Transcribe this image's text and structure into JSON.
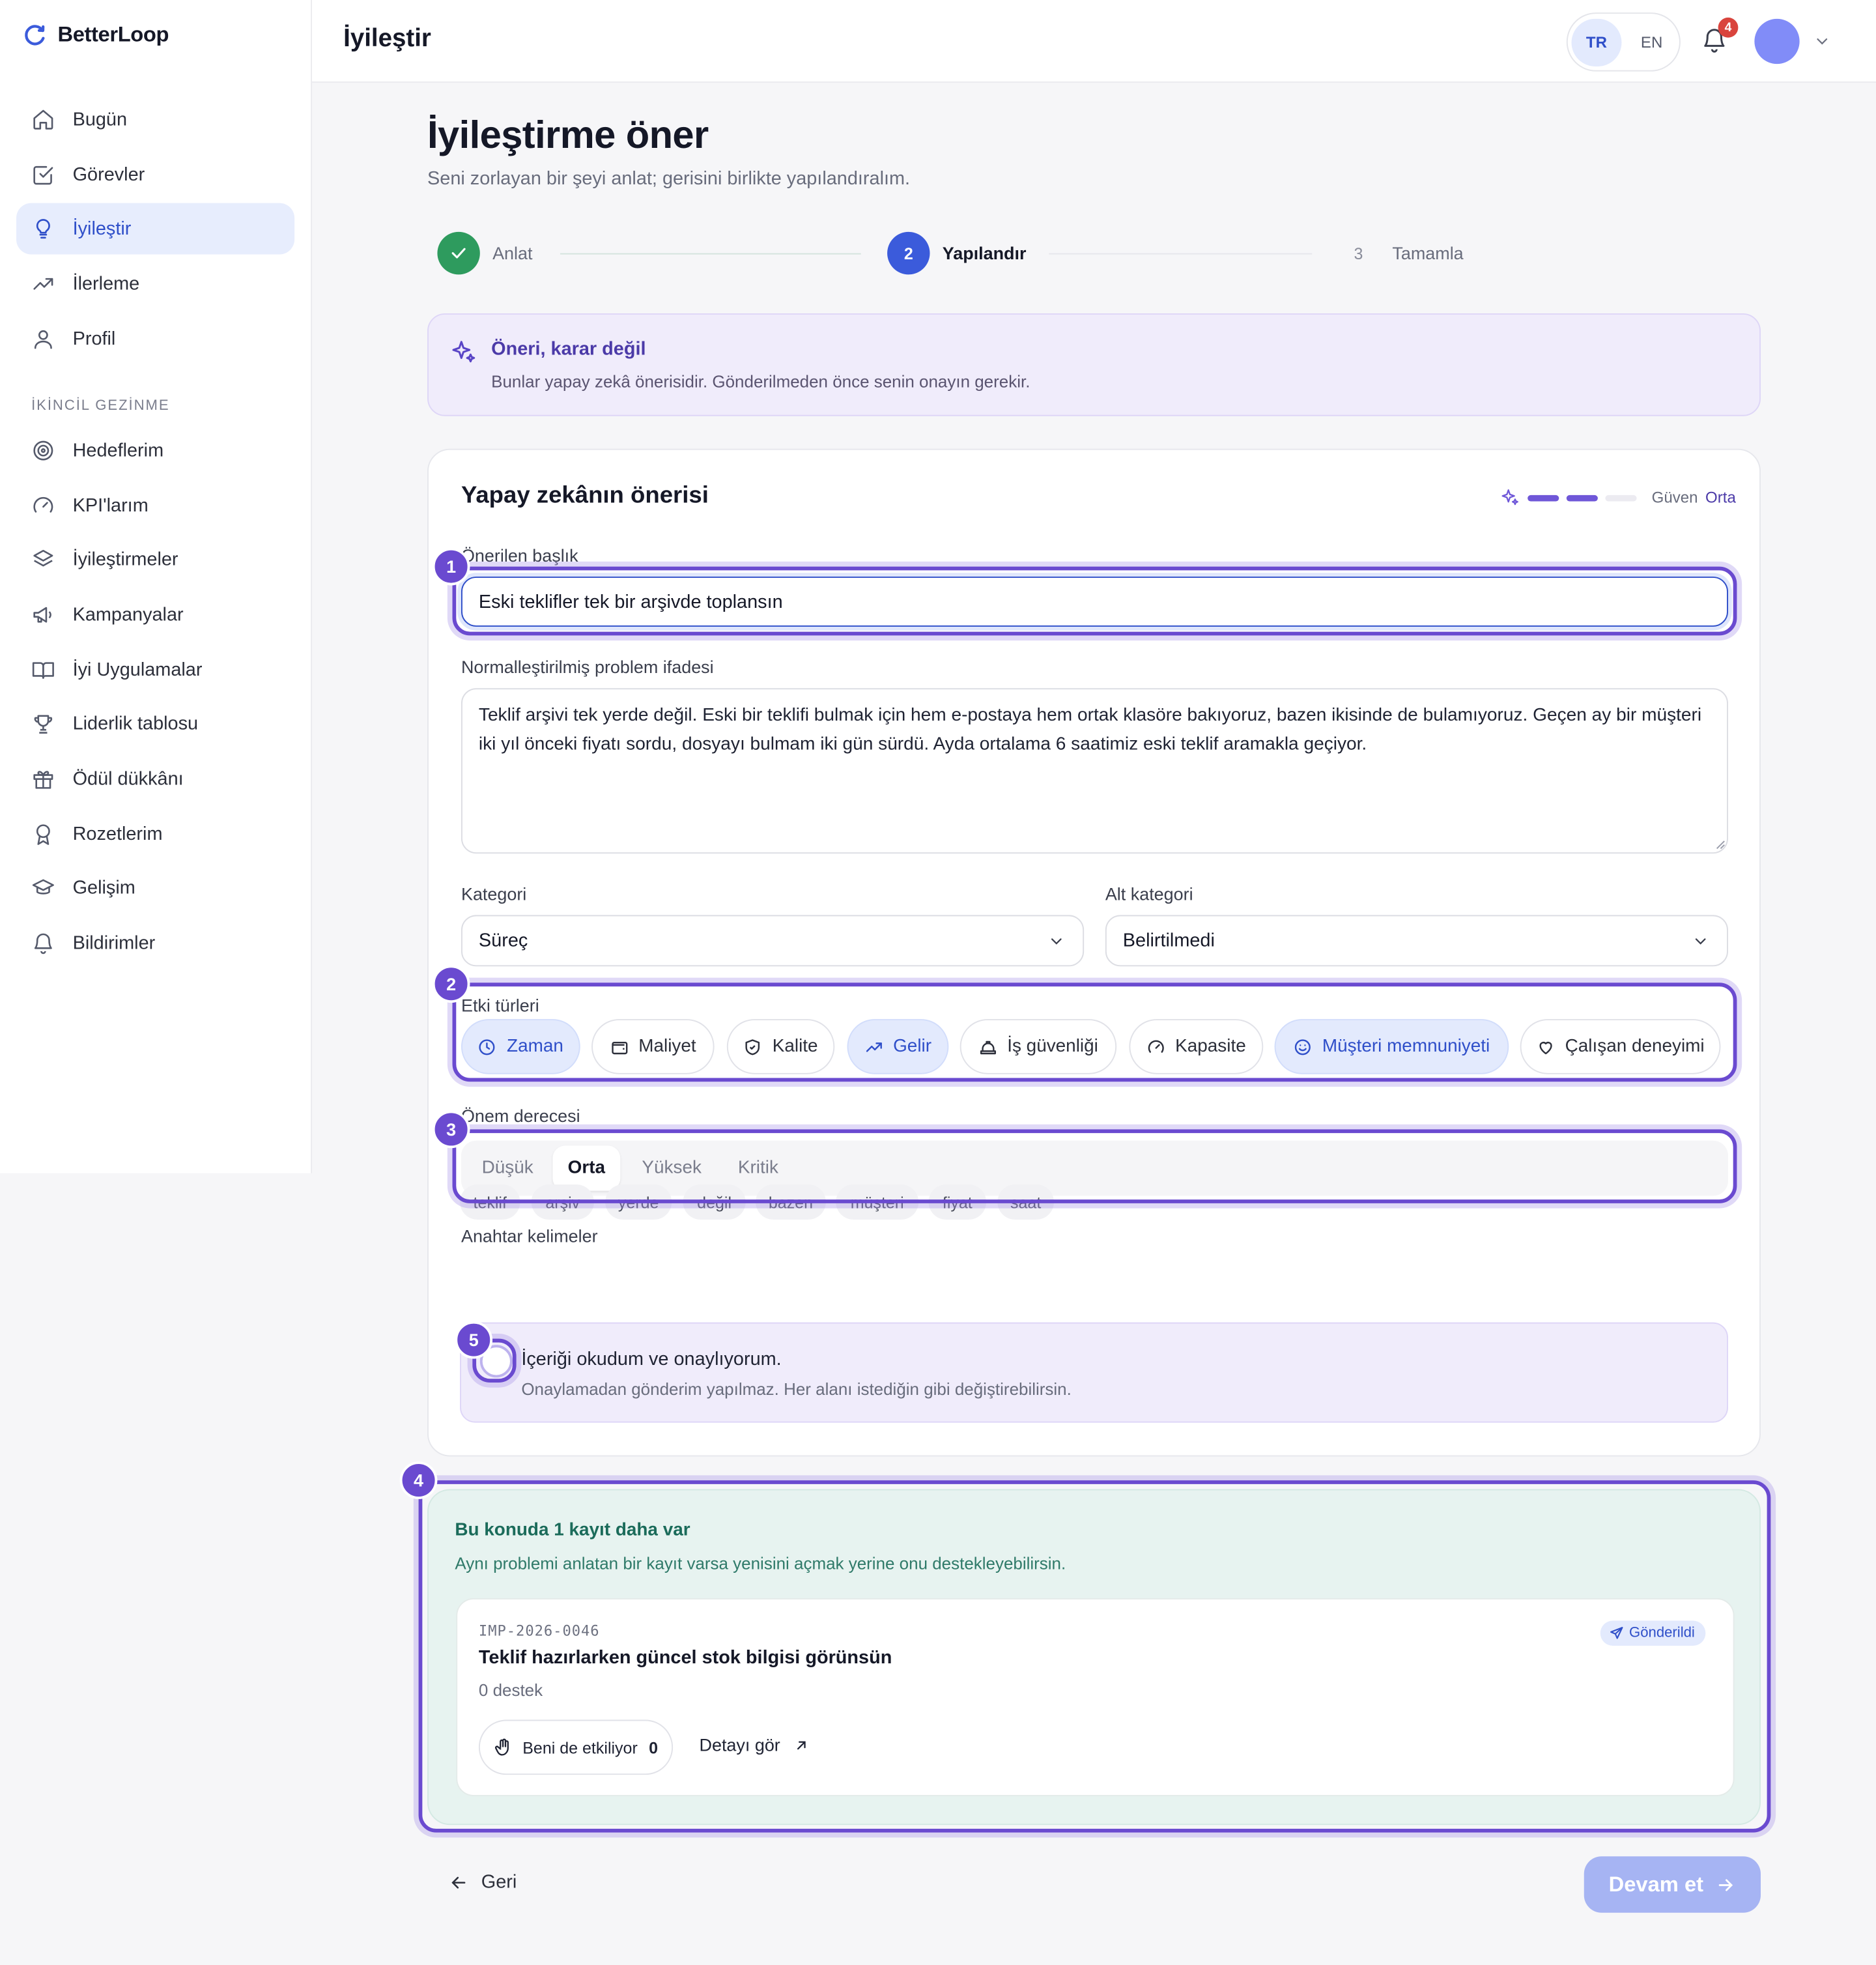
{
  "brand": {
    "name": "BetterLoop"
  },
  "sidebar": {
    "items": [
      {
        "label": "Bugün",
        "icon": "home-icon"
      },
      {
        "label": "Görevler",
        "icon": "check-square-icon"
      },
      {
        "label": "İyileştir",
        "icon": "lightbulb-icon",
        "active": true
      },
      {
        "label": "İlerleme",
        "icon": "trending-up-icon"
      },
      {
        "label": "Profil",
        "icon": "user-icon"
      }
    ],
    "secondary_title": "İKİNCİL GEZİNME",
    "secondary_items": [
      {
        "label": "Hedeflerim",
        "icon": "target-icon"
      },
      {
        "label": "KPI'larım",
        "icon": "gauge-icon"
      },
      {
        "label": "İyileştirmeler",
        "icon": "layers-icon"
      },
      {
        "label": "Kampanyalar",
        "icon": "megaphone-icon"
      },
      {
        "label": "İyi Uygulamalar",
        "icon": "book-icon"
      },
      {
        "label": "Liderlik tablosu",
        "icon": "trophy-icon"
      },
      {
        "label": "Ödül dükkânı",
        "icon": "gift-icon"
      },
      {
        "label": "Rozetlerim",
        "icon": "award-icon"
      },
      {
        "label": "Gelişim",
        "icon": "graduation-cap-icon"
      },
      {
        "label": "Bildirimler",
        "icon": "bell-icon"
      }
    ]
  },
  "topbar": {
    "title": "İyileştir",
    "lang": [
      "TR",
      "EN"
    ],
    "notification_count": "4"
  },
  "page": {
    "title": "İyileştirme öner",
    "subtitle": "Seni zorlayan bir şeyi anlat; gerisini birlikte yapılandıralım."
  },
  "steps": [
    {
      "number": "1",
      "label": "Anlat",
      "state": "done"
    },
    {
      "number": "2",
      "label": "Yapılandır",
      "state": "current"
    },
    {
      "number": "3",
      "label": "Tamamla",
      "state": "upcoming"
    }
  ],
  "notice": {
    "title": "Öneri, karar değil",
    "text": "Bunlar yapay zekâ önerisidir. Gönderilmeden önce senin onayın gerekir."
  },
  "suggestion": {
    "title": "Yapay zekânın önerisi",
    "confidence_label": "Güven",
    "confidence_value": "Orta",
    "confidence_level": 0.67,
    "title_label": "Önerilen başlık",
    "title_value": "Eski teklifler tek bir arşivde toplansın",
    "problem_label": "Normalleştirilmiş problem ifadesi",
    "problem_value": "Teklif arşivi tek yerde değil. Eski bir teklifi bulmak için hem e-postaya hem ortak klasöre bakıyoruz, bazen ikisinde de bulamıyoruz. Geçen ay bir müşteri iki yıl önceki fiyatı sordu, dosyayı bulmam iki gün sürdü. Ayda ortalama 6 saatimiz eski teklif aramakla geçiyor.",
    "category_label": "Kategori",
    "category_value": "Süreç",
    "subcategory_label": "Alt kategori",
    "subcategory_value": "Belirtilmedi",
    "impact_label": "Etki türleri",
    "impacts": [
      {
        "label": "Zaman",
        "icon": "clock-icon",
        "selected": true
      },
      {
        "label": "Maliyet",
        "icon": "wallet-icon",
        "selected": false
      },
      {
        "label": "Kalite",
        "icon": "shield-check-icon",
        "selected": false
      },
      {
        "label": "Gelir",
        "icon": "trending-up-icon",
        "selected": true
      },
      {
        "label": "İş güvenliği",
        "icon": "hard-hat-icon",
        "selected": false
      },
      {
        "label": "Kapasite",
        "icon": "gauge-icon",
        "selected": false
      },
      {
        "label": "Müşteri memnuniyeti",
        "icon": "smile-icon",
        "selected": true
      },
      {
        "label": "Çalışan deneyimi",
        "icon": "heart-icon",
        "selected": false
      }
    ],
    "priority_label": "Önem derecesi",
    "priorities": [
      "Düşük",
      "Orta",
      "Yüksek",
      "Kritik"
    ],
    "priority_selected": "Orta",
    "keywords_label": "Anahtar kelimeler",
    "keywords": [
      "teklif",
      "arşiv",
      "yerde",
      "değil",
      "bazen",
      "müşteri",
      "fiyat",
      "saat"
    ],
    "consent_title": "İçeriği okudum ve onaylıyorum.",
    "consent_text": "Onaylamadan gönderim yapılmaz. Her alanı istediğin gibi değiştirebilirsin.",
    "consent_checked": false
  },
  "duplicates": {
    "title": "Bu konuda 1 kayıt daha var",
    "text": "Aynı problemi anlatan bir kayıt varsa yenisini açmak yerine onu destekleyebilirsin.",
    "items": [
      {
        "id": "IMP-2026-0046",
        "title": "Teklif hazırlarken güncel stok bilgisi görünsün",
        "support": "0 destek",
        "status": "Gönderildi",
        "affect_label": "Beni de etkiliyor",
        "affect_count": "0",
        "detail_label": "Detayı gör"
      }
    ]
  },
  "footer": {
    "back_label": "Geri",
    "next_label": "Devam et"
  },
  "tour_markers": [
    "1",
    "2",
    "3",
    "4",
    "5"
  ],
  "colors": {
    "accent": "#2f4fc9",
    "ai_purple": "#6a4ad0",
    "success": "#2e9b5e",
    "duplicate_bg": "#e7f3f0",
    "primary_disabled": "#a6b4f3"
  }
}
